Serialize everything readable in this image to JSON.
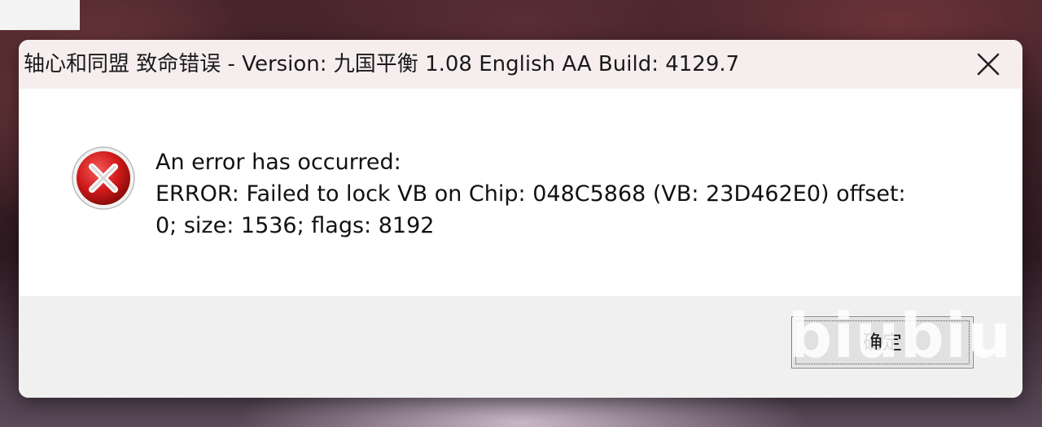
{
  "dialog": {
    "title": "轴心和同盟 致命错误 - Version: 九国平衡 1.08 English AA Build: 4129.7",
    "close_icon": "close-icon",
    "error_icon": "error-icon",
    "message": {
      "line1": "An error has occurred:",
      "line2": "ERROR: Failed to lock VB on Chip: 048C5868 (VB: 23D462E0) offset:",
      "line3": "0; size: 1536; flags: 8192"
    },
    "ok_label": "确定",
    "watermark": "biubiu"
  },
  "colors": {
    "titlebar_bg": "#f6eeee",
    "footer_bg": "#f0f0f0",
    "error_red": "#c8102e"
  }
}
